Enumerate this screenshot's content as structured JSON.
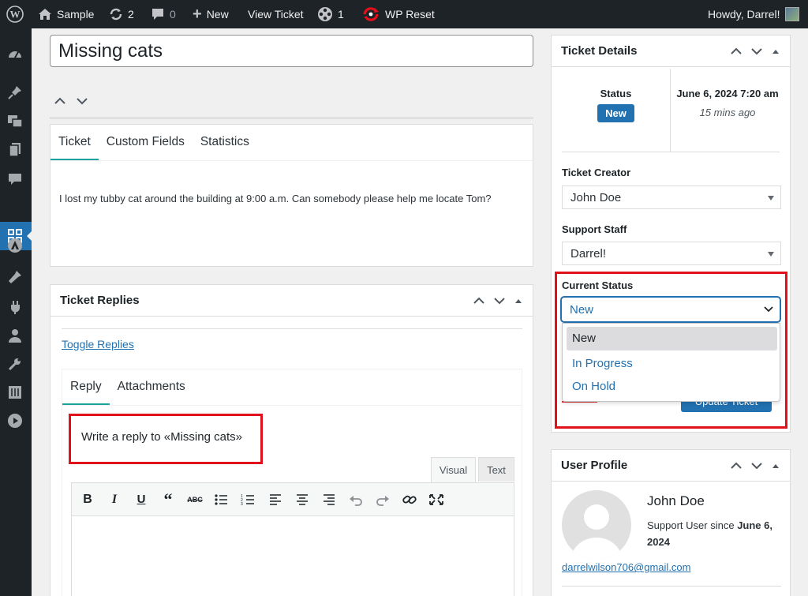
{
  "admin_bar": {
    "site_name": "Sample",
    "updates_count": "2",
    "comments_count": "0",
    "new_label": "New",
    "view_ticket_label": "View Ticket",
    "plugin_count": "1",
    "wp_reset_label": "WP Reset",
    "greeting": "Howdy, Darrel!"
  },
  "ticket": {
    "title": "Missing cats",
    "tabs": [
      "Ticket",
      "Custom Fields",
      "Statistics"
    ],
    "active_tab": "Ticket",
    "body": "I lost my tubby cat around the building at 9:00 a.m. Can somebody please help me locate Tom?"
  },
  "replies": {
    "heading": "Ticket Replies",
    "toggle_link": "Toggle Replies",
    "tabs": [
      "Reply",
      "Attachments"
    ],
    "reply_heading": "Write a reply to «Missing cats»",
    "editor_tabs": {
      "visual": "Visual",
      "text": "Text"
    },
    "toolbar": [
      "bold-icon",
      "italic-icon",
      "underline-icon",
      "blockquote-icon",
      "strikethrough-icon",
      "bullet-list-icon",
      "numbered-list-icon",
      "align-left-icon",
      "align-center-icon",
      "align-right-icon",
      "undo-icon",
      "redo-icon",
      "link-icon",
      "fullscreen-icon"
    ]
  },
  "ticket_details": {
    "heading": "Ticket Details",
    "status_label": "Status",
    "status_badge": "New",
    "date": "June 6, 2024 7:20 am",
    "ago": "15 mins ago",
    "creator_label": "Ticket Creator",
    "creator_value": "John Doe",
    "staff_label": "Support Staff",
    "staff_value": "Darrel!",
    "current_status_label": "Current Status",
    "current_status_value": "New",
    "status_options": [
      "New",
      "In Progress",
      "On Hold"
    ],
    "highlighted_option": "New",
    "update_button": "Update Ticket"
  },
  "user_profile": {
    "heading": "User Profile",
    "name": "John Doe",
    "since_prefix": "Support User since",
    "since_date": "June 6, 2024",
    "email": "darrelwilson706@gmail.com"
  },
  "colors": {
    "admin_bar_bg": "#1d2327",
    "accent_blue": "#2271b1",
    "tab_underline": "#1aa39c",
    "highlight_red": "#e0111a"
  }
}
